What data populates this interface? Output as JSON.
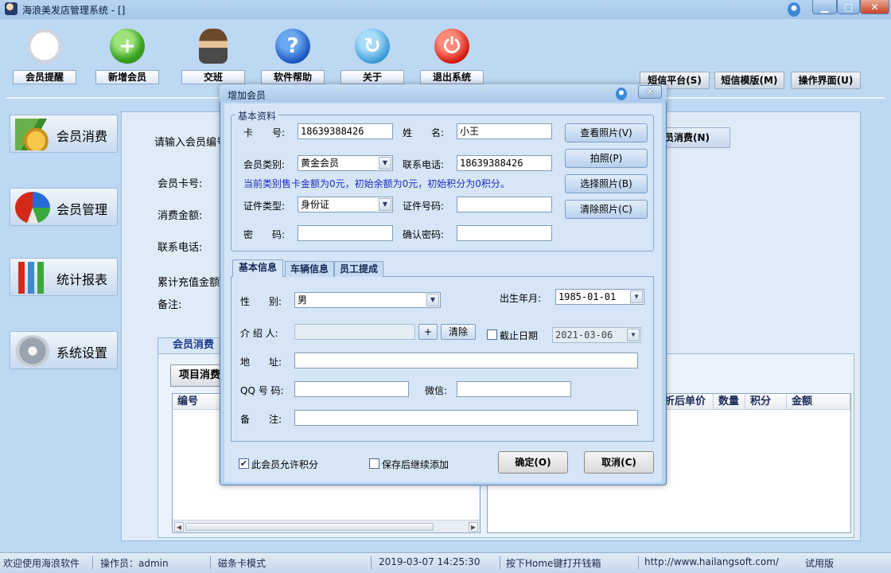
{
  "window": {
    "title": "海浪美发店管理系统 - []",
    "icon": "app-logo-icon",
    "controls": [
      "minimize-icon",
      "maximize-icon",
      "close-icon"
    ]
  },
  "toolbar": {
    "items": [
      {
        "label": "会员提醒",
        "icon": "clock-icon"
      },
      {
        "label": "新增会员",
        "icon": "add-icon"
      },
      {
        "label": "交班",
        "icon": "person-icon"
      },
      {
        "label": "软件帮助",
        "icon": "help-icon"
      },
      {
        "label": "关于",
        "icon": "refresh-icon"
      },
      {
        "label": "退出系统",
        "icon": "power-icon"
      }
    ],
    "right_buttons": [
      "短信平台(S)",
      "短信模版(M)",
      "操作界面(U)"
    ]
  },
  "nav": {
    "items": [
      {
        "label": "会员消费",
        "icon": "coins-icon"
      },
      {
        "label": "会员管理",
        "icon": "pie-chart-icon"
      },
      {
        "label": "统计报表",
        "icon": "bar-chart-icon"
      },
      {
        "label": "系统设置",
        "icon": "gear-icon"
      }
    ]
  },
  "main": {
    "enter_card_label": "请输入会员编号",
    "card_label": "会员卡号:",
    "amount_label": "消费金额:",
    "phone_label": "联系电话:",
    "recharge_label": "累计充值金额",
    "remark_label": "备注:",
    "right_button": "员消费(N)",
    "tab_label": "会员消费",
    "item_button": "项目消费",
    "left_grid_headers": [
      "编号"
    ],
    "right_grid_headers": [
      "折后单价",
      "数量",
      "积分",
      "金额"
    ]
  },
  "status": {
    "welcome": "欢迎使用海浪软件",
    "operator": "操作员：admin",
    "mode": "磁条卡模式",
    "datetime": "2019-03-07 14:25:30",
    "hint": "按下Home键打开钱箱",
    "url": "http://www.hailangsoft.com/",
    "edition": "试用版"
  },
  "dialog": {
    "title": "增加会员",
    "close_label": "✕",
    "group_title": "基本资料",
    "card_no": {
      "label": "卡　　号:",
      "value": "18639388426"
    },
    "name": {
      "label": "姓　　名:",
      "value": "小王"
    },
    "member_type": {
      "label": "会员类别:",
      "value": "黄金会员"
    },
    "contact_phone": {
      "label": "联系电话:",
      "value": "18639388426"
    },
    "info_line": "当前类别售卡金额为0元，初始余额为0元，初始积分为0积分。",
    "id_type": {
      "label": "证件类型:",
      "value": "身份证"
    },
    "id_no": {
      "label": "证件号码:",
      "value": ""
    },
    "password": {
      "label": "密　　码:",
      "value": ""
    },
    "confirm_password": {
      "label": "确认密码:",
      "value": ""
    },
    "photo_buttons": [
      "查看照片(V)",
      "拍照(P)",
      "选择照片(B)",
      "清除照片(C)"
    ],
    "tabs": [
      "基本信息",
      "车辆信息",
      "员工提成"
    ],
    "gender": {
      "label": "性　　别:",
      "value": "男"
    },
    "birth": {
      "label": "出生年月:",
      "value": "1985-01-01"
    },
    "referrer": {
      "label": "介 绍 人:",
      "value": "",
      "add_label": "+",
      "clear_label": "清除"
    },
    "expiry": {
      "label": "截止日期",
      "checked": false,
      "value": "2021-03-06"
    },
    "address": {
      "label": "地　　址:",
      "value": ""
    },
    "qq": {
      "label": "QQ 号 码:",
      "value": ""
    },
    "wechat": {
      "label": "微信:",
      "value": ""
    },
    "remark": {
      "label": "备　　注:",
      "value": ""
    },
    "allow_points": {
      "label": "此会员允许积分",
      "checked": true,
      "mark": "✔"
    },
    "continue_add": {
      "label": "保存后继续添加",
      "checked": false
    },
    "ok_label": "确定(O)",
    "cancel_label": "取消(C)"
  },
  "colors": {
    "background": "#bcd8f2",
    "dialog_bg": "#d6e6f6",
    "info_text": "#1a2ac0",
    "close_red": "#c8442a"
  }
}
